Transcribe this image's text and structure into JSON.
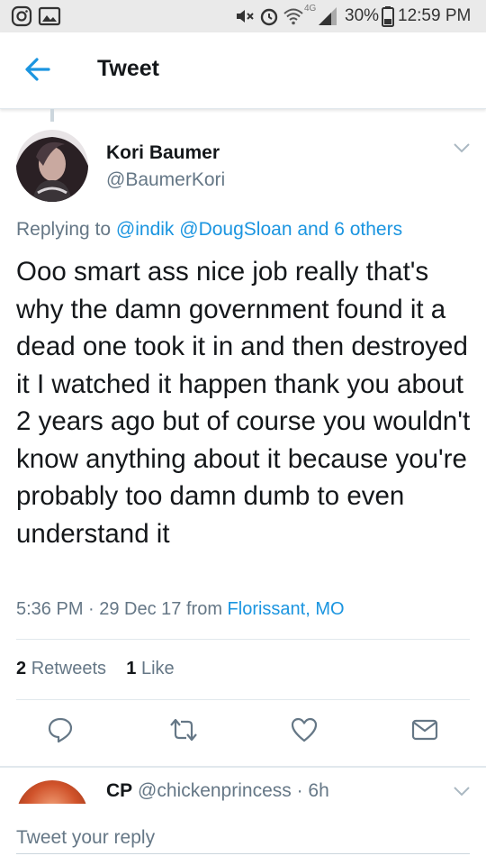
{
  "status_bar": {
    "battery": "30%",
    "time": "12:59 PM",
    "network": "4G",
    "icons": [
      "instagram-icon",
      "gallery-icon",
      "mute-icon",
      "alarm-icon",
      "wifi-icon",
      "signal-icon",
      "battery-icon"
    ]
  },
  "header": {
    "title": "Tweet",
    "back_icon": "back-arrow-icon"
  },
  "tweet": {
    "author_name": "Kori Baumer",
    "author_handle": "@BaumerKori",
    "replying_prefix": "Replying to ",
    "replying_to": [
      "@indik",
      "@DougSloan"
    ],
    "replying_others": "and 6 others",
    "text": "Ooo smart ass nice job really that's why the damn government found it a dead one took it in and then destroyed it I watched it happen thank you about 2 years ago but of course you wouldn't know anything about it because you're probably too damn dumb to even understand it",
    "time": "5:36 PM · 29 Dec 17 from",
    "location": "Florissant, MO",
    "retweets_count": "2",
    "retweets_label": "Retweets",
    "likes_count": "1",
    "likes_label": "Like",
    "accent_color": "#1b95e0"
  },
  "next_reply": {
    "author_name": "CP",
    "author_handle": "@chickenprincess",
    "age": "· 6h"
  },
  "compose": {
    "placeholder": "Tweet your reply"
  }
}
